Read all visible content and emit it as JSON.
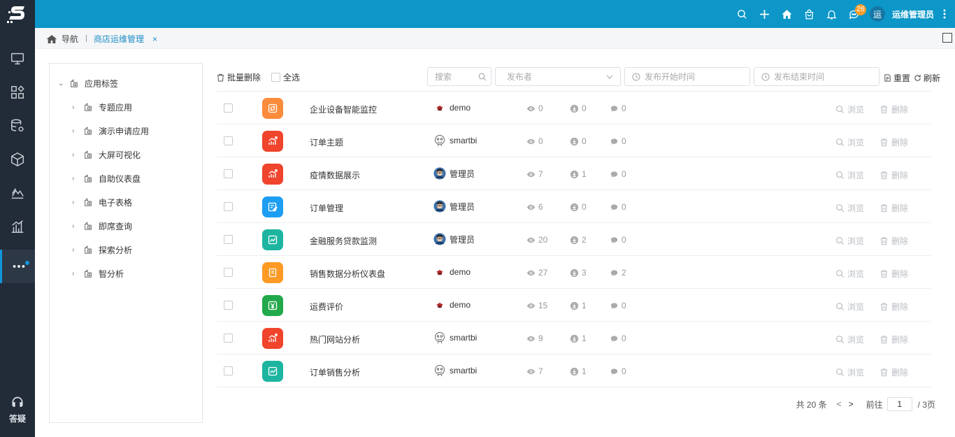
{
  "header": {
    "badge_count": "26",
    "avatar_letter": "运",
    "username": "运维管理员"
  },
  "rail": {
    "help_label": "答疑"
  },
  "breadcrumb": {
    "home_label": "导航",
    "tab_label": "商店运维管理",
    "close_glyph": "×"
  },
  "tree": {
    "root": "应用标签",
    "children": [
      "专题应用",
      "演示申请应用",
      "大屏可视化",
      "自助仪表盘",
      "电子表格",
      "即席查询",
      "探索分析",
      "智分析"
    ]
  },
  "toolbar": {
    "bulk_delete": "批量删除",
    "select_all": "全选",
    "search_placeholder": "搜索",
    "publisher_placeholder": "发布者",
    "start_placeholder": "发布开始时间",
    "end_placeholder": "发布结束时间",
    "reset": "重置",
    "refresh": "刷新"
  },
  "actions": {
    "browse": "浏览",
    "delete": "删除"
  },
  "rows": [
    {
      "name": "企业设备智能监控",
      "publisher": "demo",
      "pub_avatar": "demo",
      "views": "0",
      "downloads": "0",
      "comments": "0",
      "icon": "monitor-app-icon",
      "color": "#fb8c3c"
    },
    {
      "name": "订单主题",
      "publisher": "smartbi",
      "pub_avatar": "smartbi",
      "views": "0",
      "downloads": "0",
      "comments": "0",
      "icon": "chart-growth-icon",
      "color": "#f0442c"
    },
    {
      "name": "疫情数据展示",
      "publisher": "管理员",
      "pub_avatar": "admin",
      "views": "7",
      "downloads": "1",
      "comments": "0",
      "icon": "chart-growth-icon",
      "color": "#f0442c"
    },
    {
      "name": "订单管理",
      "publisher": "管理员",
      "pub_avatar": "admin",
      "views": "6",
      "downloads": "0",
      "comments": "0",
      "icon": "edit-sheet-icon",
      "color": "#1e9ef3"
    },
    {
      "name": "金融服务贷款监测",
      "publisher": "管理员",
      "pub_avatar": "admin",
      "views": "20",
      "downloads": "2",
      "comments": "0",
      "icon": "line-chart-icon",
      "color": "#1db5a0"
    },
    {
      "name": "销售数据分析仪表盘",
      "publisher": "demo",
      "pub_avatar": "demo",
      "views": "27",
      "downloads": "3",
      "comments": "2",
      "icon": "dashboard-icon",
      "color": "#fd9a24"
    },
    {
      "name": "运费评价",
      "publisher": "demo",
      "pub_avatar": "demo",
      "views": "15",
      "downloads": "1",
      "comments": "0",
      "icon": "yen-icon",
      "color": "#22a94c"
    },
    {
      "name": "热门网站分析",
      "publisher": "smartbi",
      "pub_avatar": "smartbi",
      "views": "9",
      "downloads": "1",
      "comments": "0",
      "icon": "chart-growth-icon",
      "color": "#f0442c"
    },
    {
      "name": "订单销售分析",
      "publisher": "smartbi",
      "pub_avatar": "smartbi",
      "views": "7",
      "downloads": "1",
      "comments": "0",
      "icon": "line-chart-icon",
      "color": "#1db5a0"
    }
  ],
  "pagination": {
    "total": "共 20 条",
    "goto_label": "前往",
    "page_value": "1",
    "pages_suffix": "/ 3页"
  }
}
